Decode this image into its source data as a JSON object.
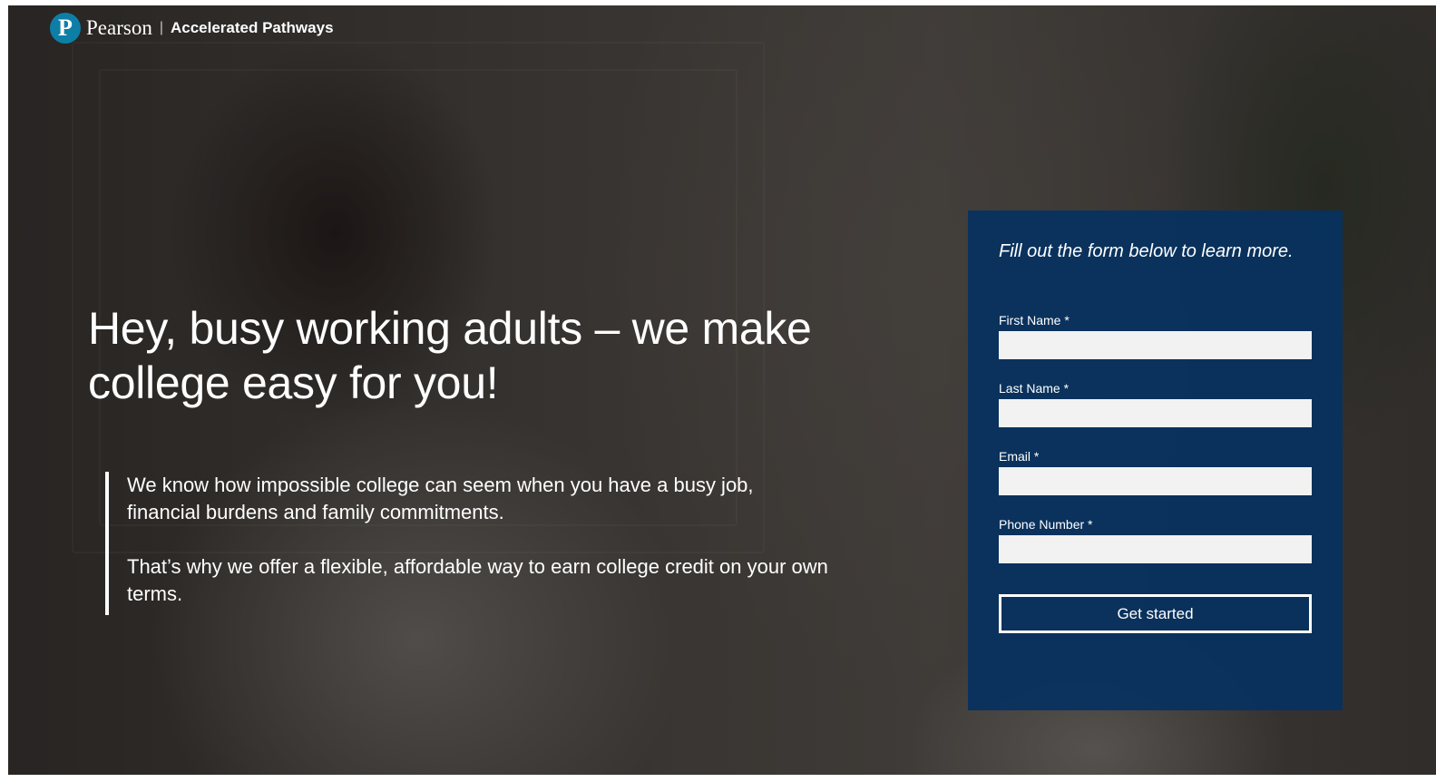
{
  "brand": {
    "logo_letter": "P",
    "name": "Pearson",
    "separator": "|",
    "product": "Accelerated Pathways"
  },
  "hero": {
    "headline": "Hey, busy working adults – we make college easy for you!",
    "paragraphs": [
      "We know how impossible college can seem when you have a busy job, financial burdens and family commitments.",
      "That’s why we offer a flexible, affordable way to earn college credit on your own terms."
    ]
  },
  "form": {
    "title": "Fill out the form below to learn more.",
    "fields": [
      {
        "label": "First Name *",
        "value": ""
      },
      {
        "label": "Last Name *",
        "value": ""
      },
      {
        "label": "Email *",
        "value": ""
      },
      {
        "label": "Phone Number *",
        "value": ""
      }
    ],
    "submit_label": "Get started"
  },
  "colors": {
    "form_panel": "#063260",
    "logo_circle": "#0d7fa6",
    "text": "#ffffff"
  }
}
